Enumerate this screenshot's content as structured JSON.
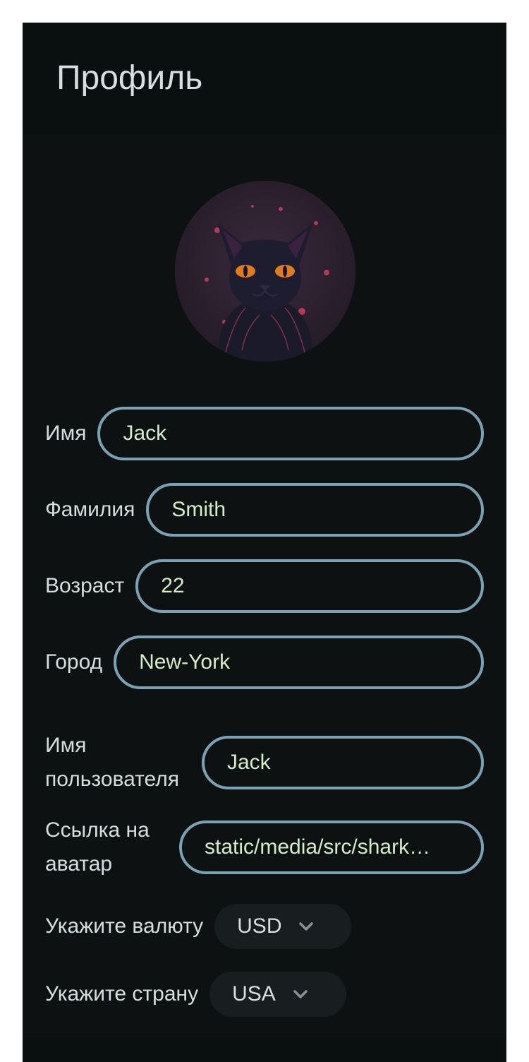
{
  "header": {
    "title": "Профиль"
  },
  "avatar": {
    "icon": "cat-avatar"
  },
  "fields": {
    "first_name": {
      "label": "Имя",
      "value": "Jack"
    },
    "last_name": {
      "label": "Фамилия",
      "value": "Smith"
    },
    "age": {
      "label": "Возраст",
      "value": "22"
    },
    "city": {
      "label": "Город",
      "value": "New-York"
    },
    "username": {
      "label": "Имя пользователя",
      "value": "Jack"
    },
    "avatar_link": {
      "label": "Ссылка на аватар",
      "value": "static/media/src/shark…"
    }
  },
  "currency": {
    "label": "Укажите валюту",
    "selected": "USD"
  },
  "country": {
    "label": "Укажите страну",
    "selected": "USA"
  },
  "colors": {
    "card_bg": "#0d1112",
    "input_border": "#7ba2b4",
    "input_text": "#d6ecc9",
    "label_text": "#d7dcde"
  }
}
